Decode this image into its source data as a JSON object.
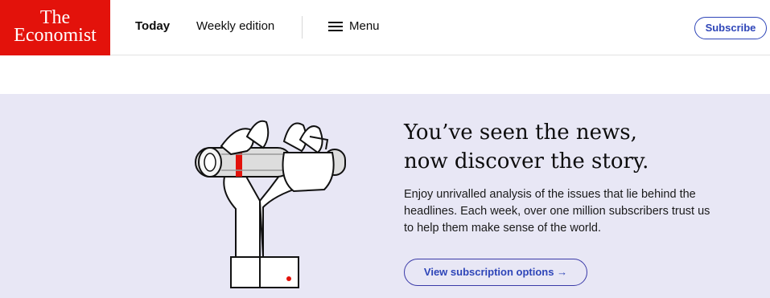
{
  "logo": {
    "line1": "The",
    "line2": "Economist"
  },
  "nav": {
    "today": "Today",
    "weekly": "Weekly edition",
    "menu": "Menu",
    "subscribe": "Subscribe"
  },
  "promo": {
    "headline_line1": "You’ve seen the news,",
    "headline_line2": "now discover the story.",
    "body": "Enjoy unrivalled analysis of the issues that lie behind the headlines. Each week, over one million subscribers trust us to help them make sense of the world.",
    "cta": "View subscription options →"
  },
  "colors": {
    "brand_red": "#e3120b",
    "accent_blue": "#2e45b8",
    "banner_bg": "#e8e7f5"
  }
}
